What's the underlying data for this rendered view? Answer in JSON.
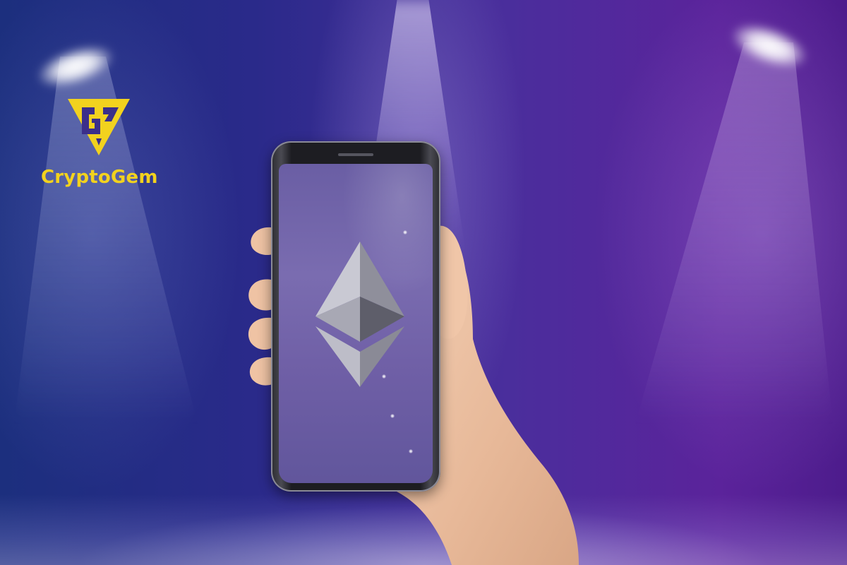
{
  "brand": {
    "name": "CryptoGem",
    "logo_icon": "cryptogem-triangle-logo-icon",
    "color": "#f2d21e"
  },
  "scene": {
    "phone_icon": "ethereum-logo-icon",
    "phone_icon_color": "#b8b8c4",
    "background_colors": [
      "#1c2f7e",
      "#4a2e9c",
      "#5b239b"
    ]
  }
}
